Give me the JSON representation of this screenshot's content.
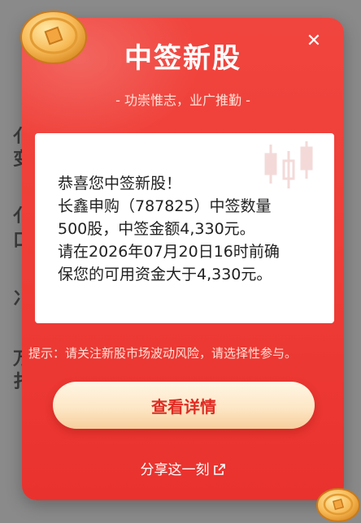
{
  "modal": {
    "title": "中签新股",
    "subtitle": "- 功崇惟志，业广推勤 -",
    "close_icon": "close-icon",
    "message_lines": [
      "恭喜您中签新股！",
      "长鑫申购（787825）中签数量",
      "500股，中签金额4,330元。",
      "请在2026年07月20日16时前确",
      "保您的可用资金大于4,330元。"
    ],
    "tip": "提示：请关注新股市场波动风险，请选择性参与。",
    "primary_button": "查看详情",
    "share_label": "分享这一刻",
    "share_icon": "external-link-icon"
  },
  "colors": {
    "modal_red": "#ef3e37",
    "button_gold": "#fde7c7",
    "button_text": "#e02b23"
  }
}
